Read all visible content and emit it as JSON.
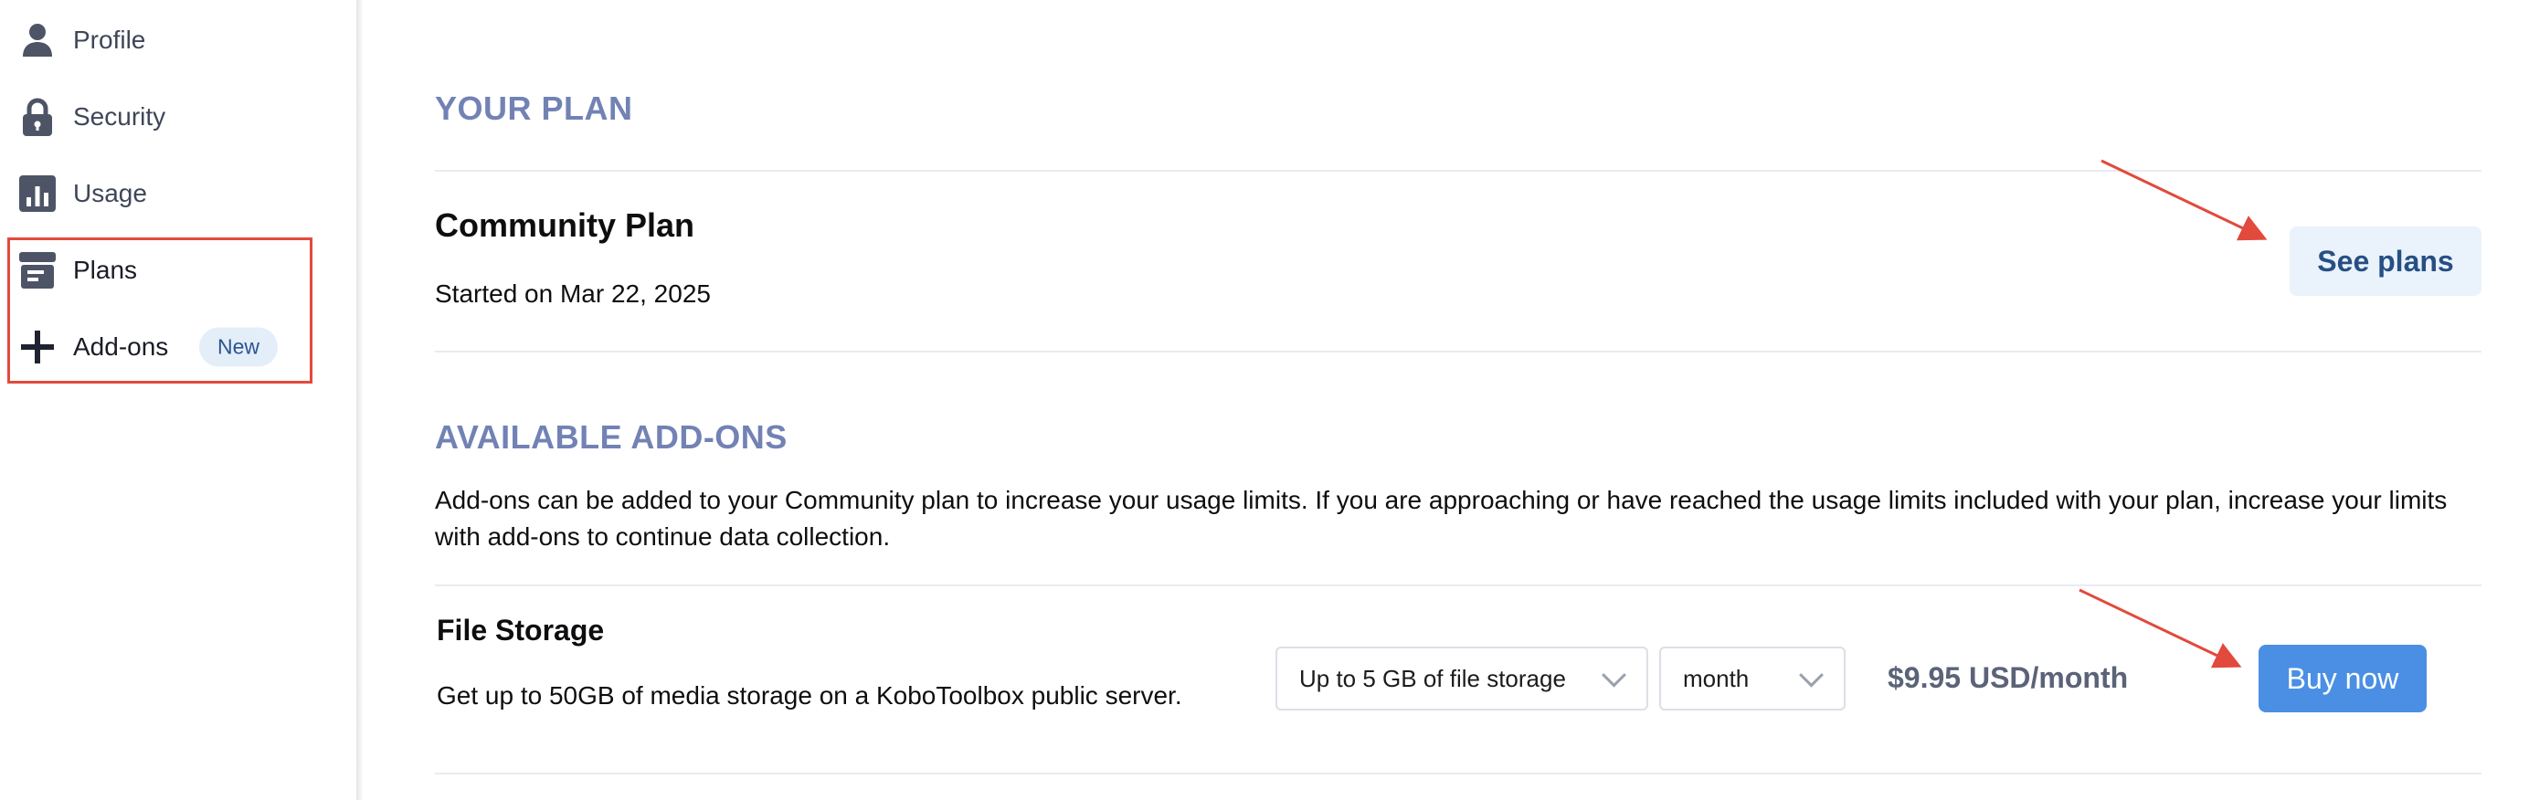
{
  "sidebar": {
    "items": [
      {
        "label": "Profile",
        "icon": "person-icon"
      },
      {
        "label": "Security",
        "icon": "lock-icon"
      },
      {
        "label": "Usage",
        "icon": "bar-chart-icon"
      },
      {
        "label": "Plans",
        "icon": "archive-box-icon"
      },
      {
        "label": "Add-ons",
        "icon": "plus-icon",
        "badge": "New"
      }
    ]
  },
  "plan": {
    "section_title": "YOUR PLAN",
    "name": "Community Plan",
    "started": "Started on Mar 22, 2025",
    "see_plans_label": "See plans"
  },
  "addons": {
    "section_title": "AVAILABLE ADD-ONS",
    "description": "Add-ons can be added to your Community plan to increase your usage limits. If you are approaching or have reached the usage limits included with your plan, increase your limits with add-ons to continue data collection.",
    "products": [
      {
        "name": "File Storage",
        "description": "Get up to 50GB of media storage on a KoboToolbox public server.",
        "storage_option": "Up to 5 GB of file storage",
        "period_option": "month",
        "price": "$9.95 USD/month",
        "buy_label": "Buy now"
      }
    ]
  },
  "colors": {
    "accent": "#4a8fe3",
    "section_title": "#7282b4",
    "annotation": "#e14a3c",
    "badge_bg": "#e3eef9"
  }
}
